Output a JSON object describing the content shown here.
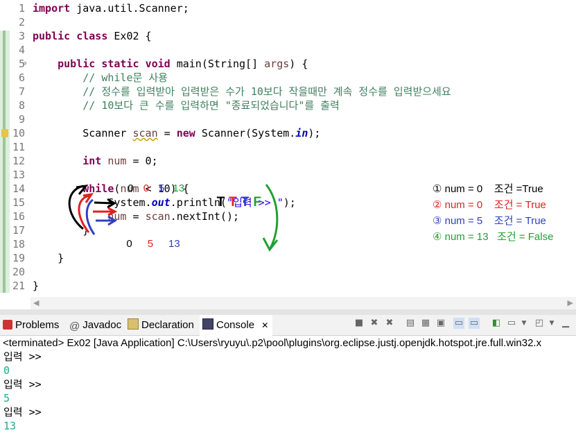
{
  "editor": {
    "lines": [
      {
        "n": "1",
        "html": "<span class=\"kw\">import</span> java.util.Scanner;"
      },
      {
        "n": "2",
        "html": ""
      },
      {
        "n": "3",
        "html": "<span class=\"kw\">public</span> <span class=\"kw\">class</span> Ex02 {"
      },
      {
        "n": "4",
        "html": ""
      },
      {
        "n": "5",
        "html": "    <span class=\"kw\">public</span> <span class=\"kw\">static</span> <span class=\"kw\">void</span> main(String[] <span class=\"var\">args</span>) {"
      },
      {
        "n": "6",
        "html": "        <span class=\"cm\">// while문 사용</span>"
      },
      {
        "n": "7",
        "html": "        <span class=\"cm\">// 정수를 입력받아 입력받은 수가 10보다 작을때만 계속 정수를 입력받으세요</span>"
      },
      {
        "n": "8",
        "html": "        <span class=\"cm\">// 10보다 큰 수를 입력하면 \"종료되었습니다\"를 출력</span>"
      },
      {
        "n": "9",
        "html": ""
      },
      {
        "n": "10",
        "html": "        Scanner <span class=\"var squig\">scan</span> = <span class=\"kw\">new</span> Scanner(System.<span class=\"fld\">in</span>);"
      },
      {
        "n": "11",
        "html": ""
      },
      {
        "n": "12",
        "html": "        <span class=\"kw\">int</span> <span class=\"var\">num</span> = 0;"
      },
      {
        "n": "13",
        "html": ""
      },
      {
        "n": "14",
        "html": "        <span class=\"kw\">while</span>(<span class=\"var\">num</span> &lt; 10) {"
      },
      {
        "n": "15",
        "html": "            System.<span class=\"fld\">out</span>.println(<span class=\"str\">\"입력 &gt;&gt; \"</span>);"
      },
      {
        "n": "16",
        "html": "            <span class=\"var\">num</span> = <span class=\"var\">scan</span>.nextInt();"
      },
      {
        "n": "17",
        "html": "        }"
      },
      {
        "n": "18",
        "html": ""
      },
      {
        "n": "19",
        "html": "    }"
      },
      {
        "n": "20",
        "html": ""
      },
      {
        "n": "21",
        "html": "}"
      }
    ]
  },
  "annotations": {
    "trace_top": {
      "a": "0",
      "b": "0",
      "c": "5",
      "d": "13"
    },
    "trace_bottom": {
      "a": "0",
      "b": "5",
      "c": "13"
    },
    "tf": [
      "T",
      "T",
      "T",
      "F"
    ],
    "notes": [
      {
        "text": "① num = 0    조건 =True",
        "color": "#000000"
      },
      {
        "text": "② num = 0    조건 = True",
        "color": "#e02020"
      },
      {
        "text": "③ num = 5    조건 = True",
        "color": "#3040c0"
      },
      {
        "text": "④ num = 13   조건 = False",
        "color": "#20a030"
      }
    ]
  },
  "console": {
    "tabs": [
      {
        "label": "Problems",
        "icon": "problems-icon"
      },
      {
        "label": "Javadoc",
        "icon": "at-icon"
      },
      {
        "label": "Declaration",
        "icon": "declaration-icon"
      },
      {
        "label": "Console",
        "icon": "console-icon",
        "close": "✕"
      }
    ],
    "terminated": "<terminated> Ex02 [Java Application] C:\\Users\\ryuyu\\.p2\\pool\\plugins\\org.eclipse.justj.openjdk.hotspot.jre.full.win32.x",
    "output": [
      {
        "text": "입력 >>",
        "kind": "prompt"
      },
      {
        "text": "0",
        "kind": "val"
      },
      {
        "text": "입력 >>",
        "kind": "prompt"
      },
      {
        "text": "5",
        "kind": "val"
      },
      {
        "text": "입력 >>",
        "kind": "prompt"
      },
      {
        "text": "13",
        "kind": "val"
      }
    ]
  },
  "colors": {
    "trace_red": "#e02020",
    "trace_blue": "#3040c0",
    "trace_green": "#20a030",
    "output_green": "#1eaa8a"
  }
}
